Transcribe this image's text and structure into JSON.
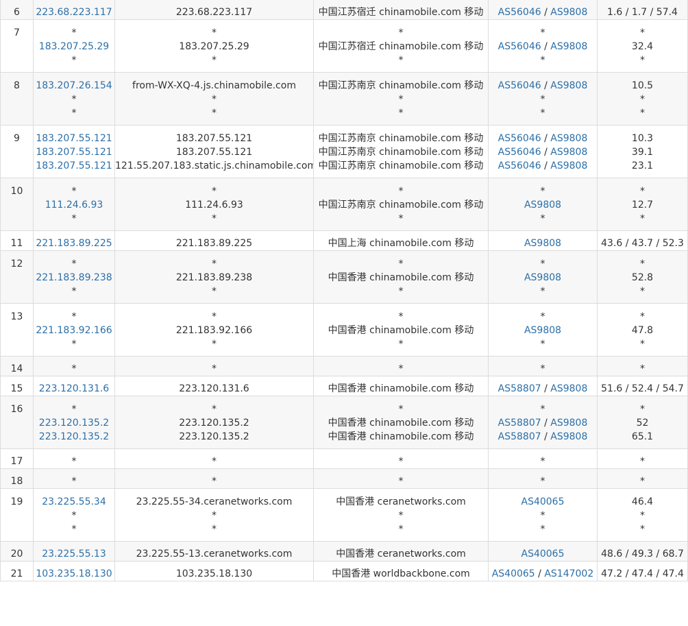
{
  "colors": {
    "link": "#2b6fa8",
    "border": "#dcdcdc",
    "alt_row": "#f7f7f7",
    "text": "#333333"
  },
  "rows": [
    {
      "hop": "6",
      "lines": [
        {
          "ip": "223.68.223.117",
          "host": "223.68.223.117",
          "geo": "中国江苏宿迁 chinamobile.com 移动",
          "asn": [
            "AS56046",
            "AS9808"
          ],
          "rtt": "1.6 / 1.7 / 57.4"
        }
      ]
    },
    {
      "hop": "7",
      "lines": [
        {
          "ip": "*",
          "host": "*",
          "geo": "*",
          "asn": [],
          "rtt": "*"
        },
        {
          "ip": "183.207.25.29",
          "host": "183.207.25.29",
          "geo": "中国江苏宿迁 chinamobile.com 移动",
          "asn": [
            "AS56046",
            "AS9808"
          ],
          "rtt": "32.4"
        },
        {
          "ip": "*",
          "host": "*",
          "geo": "*",
          "asn": [],
          "rtt": "*"
        }
      ]
    },
    {
      "hop": "8",
      "lines": [
        {
          "ip": "183.207.26.154",
          "host": "from-WX-XQ-4.js.chinamobile.com",
          "geo": "中国江苏南京 chinamobile.com 移动",
          "asn": [
            "AS56046",
            "AS9808"
          ],
          "rtt": "10.5"
        },
        {
          "ip": "*",
          "host": "*",
          "geo": "*",
          "asn": [],
          "rtt": "*"
        },
        {
          "ip": "*",
          "host": "*",
          "geo": "*",
          "asn": [],
          "rtt": "*"
        }
      ]
    },
    {
      "hop": "9",
      "lines": [
        {
          "ip": "183.207.55.121",
          "host": "183.207.55.121",
          "geo": "中国江苏南京 chinamobile.com 移动",
          "asn": [
            "AS56046",
            "AS9808"
          ],
          "rtt": "10.3"
        },
        {
          "ip": "183.207.55.121",
          "host": "183.207.55.121",
          "geo": "中国江苏南京 chinamobile.com 移动",
          "asn": [
            "AS56046",
            "AS9808"
          ],
          "rtt": "39.1"
        },
        {
          "ip": "183.207.55.121",
          "host": "121.55.207.183.static.js.chinamobile.com",
          "geo": "中国江苏南京 chinamobile.com 移动",
          "asn": [
            "AS56046",
            "AS9808"
          ],
          "rtt": "23.1"
        }
      ]
    },
    {
      "hop": "10",
      "lines": [
        {
          "ip": "*",
          "host": "*",
          "geo": "*",
          "asn": [],
          "rtt": "*"
        },
        {
          "ip": "111.24.6.93",
          "host": "111.24.6.93",
          "geo": "中国江苏南京 chinamobile.com 移动",
          "asn": [
            "AS9808"
          ],
          "rtt": "12.7"
        },
        {
          "ip": "*",
          "host": "*",
          "geo": "*",
          "asn": [],
          "rtt": "*"
        }
      ]
    },
    {
      "hop": "11",
      "lines": [
        {
          "ip": "221.183.89.225",
          "host": "221.183.89.225",
          "geo": "中国上海 chinamobile.com 移动",
          "asn": [
            "AS9808"
          ],
          "rtt": "43.6 / 43.7 / 52.3"
        }
      ]
    },
    {
      "hop": "12",
      "lines": [
        {
          "ip": "*",
          "host": "*",
          "geo": "*",
          "asn": [],
          "rtt": "*"
        },
        {
          "ip": "221.183.89.238",
          "host": "221.183.89.238",
          "geo": "中国香港 chinamobile.com 移动",
          "asn": [
            "AS9808"
          ],
          "rtt": "52.8"
        },
        {
          "ip": "*",
          "host": "*",
          "geo": "*",
          "asn": [],
          "rtt": "*"
        }
      ]
    },
    {
      "hop": "13",
      "lines": [
        {
          "ip": "*",
          "host": "*",
          "geo": "*",
          "asn": [],
          "rtt": "*"
        },
        {
          "ip": "221.183.92.166",
          "host": "221.183.92.166",
          "geo": "中国香港 chinamobile.com 移动",
          "asn": [
            "AS9808"
          ],
          "rtt": "47.8"
        },
        {
          "ip": "*",
          "host": "*",
          "geo": "*",
          "asn": [],
          "rtt": "*"
        }
      ]
    },
    {
      "hop": "14",
      "lines": [
        {
          "ip": "*",
          "host": "*",
          "geo": "*",
          "asn": [],
          "rtt": "*"
        }
      ]
    },
    {
      "hop": "15",
      "lines": [
        {
          "ip": "223.120.131.6",
          "host": "223.120.131.6",
          "geo": "中国香港 chinamobile.com 移动",
          "asn": [
            "AS58807",
            "AS9808"
          ],
          "rtt": "51.6 / 52.4 / 54.7"
        }
      ]
    },
    {
      "hop": "16",
      "lines": [
        {
          "ip": "*",
          "host": "*",
          "geo": "*",
          "asn": [],
          "rtt": "*"
        },
        {
          "ip": "223.120.135.2",
          "host": "223.120.135.2",
          "geo": "中国香港 chinamobile.com 移动",
          "asn": [
            "AS58807",
            "AS9808"
          ],
          "rtt": "52"
        },
        {
          "ip": "223.120.135.2",
          "host": "223.120.135.2",
          "geo": "中国香港 chinamobile.com 移动",
          "asn": [
            "AS58807",
            "AS9808"
          ],
          "rtt": "65.1"
        }
      ]
    },
    {
      "hop": "17",
      "lines": [
        {
          "ip": "*",
          "host": "*",
          "geo": "*",
          "asn": [],
          "rtt": "*"
        }
      ]
    },
    {
      "hop": "18",
      "lines": [
        {
          "ip": "*",
          "host": "*",
          "geo": "*",
          "asn": [],
          "rtt": "*"
        }
      ]
    },
    {
      "hop": "19",
      "lines": [
        {
          "ip": "23.225.55.34",
          "host": "23.225.55-34.ceranetworks.com",
          "geo": "中国香港 ceranetworks.com",
          "asn": [
            "AS40065"
          ],
          "rtt": "46.4"
        },
        {
          "ip": "*",
          "host": "*",
          "geo": "*",
          "asn": [],
          "rtt": "*"
        },
        {
          "ip": "*",
          "host": "*",
          "geo": "*",
          "asn": [],
          "rtt": "*"
        }
      ]
    },
    {
      "hop": "20",
      "lines": [
        {
          "ip": "23.225.55.13",
          "host": "23.225.55-13.ceranetworks.com",
          "geo": "中国香港 ceranetworks.com",
          "asn": [
            "AS40065"
          ],
          "rtt": "48.6 / 49.3 / 68.7"
        }
      ]
    },
    {
      "hop": "21",
      "lines": [
        {
          "ip": "103.235.18.130",
          "host": "103.235.18.130",
          "geo": "中国香港 worldbackbone.com",
          "asn": [
            "AS40065",
            "AS147002"
          ],
          "rtt": "47.2 / 47.4 / 47.4"
        }
      ]
    }
  ]
}
